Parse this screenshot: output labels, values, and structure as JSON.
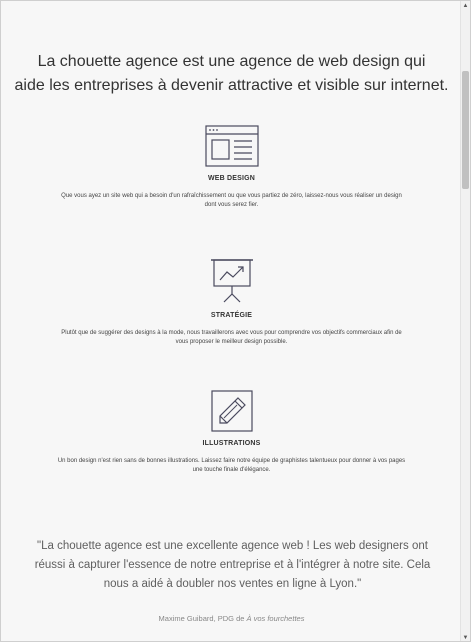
{
  "headline": {
    "line1": "La chouette agence est une agence de web design qui",
    "line2": "aide les entreprises à devenir attractive et visible sur internet."
  },
  "services": [
    {
      "icon": "web-design-icon",
      "title": "WEB DESIGN",
      "description_line1": "Que vous ayez un site web qui a besoin d'un rafraîchissement ou que vous partiez de zéro, laissez-nous vous réaliser un design",
      "description_line2": "dont vous serez fier."
    },
    {
      "icon": "presentation-chart-icon",
      "title": "STRATÉGIE",
      "description_line1": "Plutôt que de suggérer des designs à la mode, nous travaillerons avec vous pour comprendre vos objectifs commerciaux afin de",
      "description_line2": "vous proposer le meilleur design possible."
    },
    {
      "icon": "pencil-icon",
      "title": "ILLUSTRATIONS",
      "description_line1": "Un bon design n'est rien sans de bonnes illustrations. Laissez faire notre équipe de graphistes talentueux pour donner à vos pages",
      "description_line2": "une touche finale d'élégance."
    }
  ],
  "testimonial": {
    "line1": "\"La chouette agence est une excellente agence web ! Les web designers ont",
    "line2": "réussi à capturer l'essence de notre entreprise et à l'intégrer à notre site. Cela",
    "line3": "nous a aidé à doubler nos ventes en ligne à Lyon.\"",
    "author_prefix": "Maxime Guibard, PDG de ",
    "author_company": "À vos fourchettes"
  },
  "scrollbar": {
    "up_glyph": "▲",
    "down_glyph": "▼"
  },
  "colors": {
    "background": "#f7f7f7",
    "text": "#333333",
    "icon_stroke": "#4a4a5e"
  }
}
